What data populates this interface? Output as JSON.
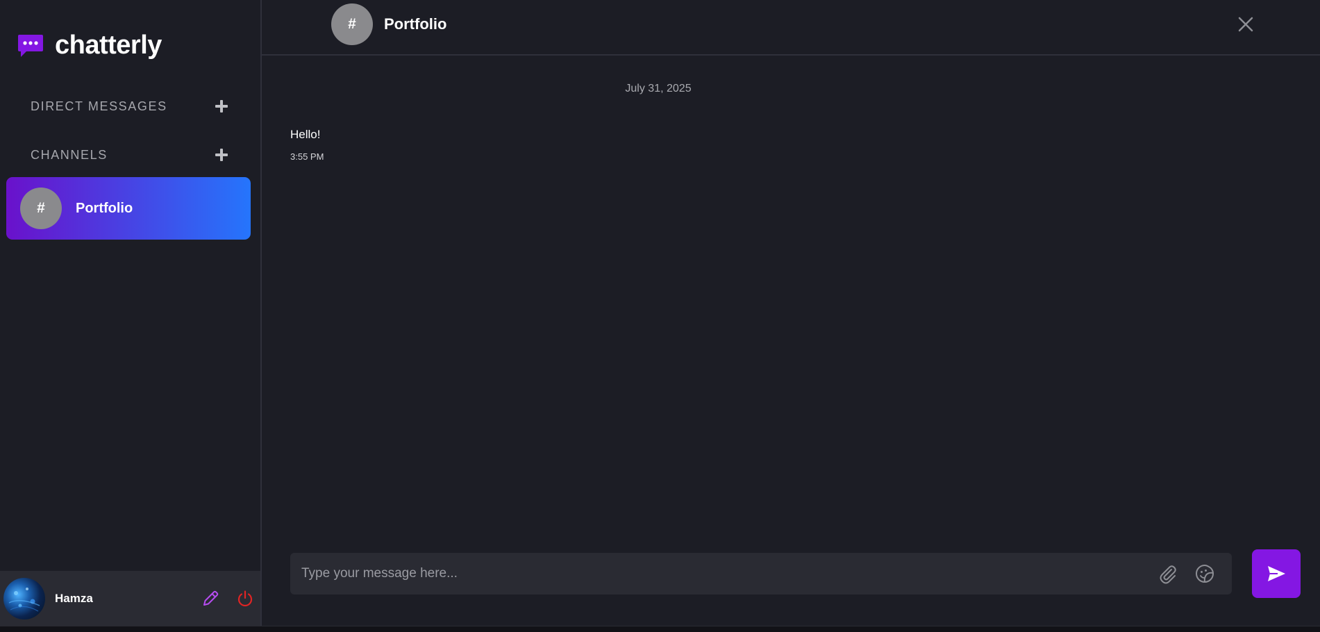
{
  "app": {
    "name": "chatterly"
  },
  "sidebar": {
    "direct_messages_title": "DIRECT MESSAGES",
    "channels_title": "CHANNELS",
    "channels": [
      {
        "symbol": "#",
        "name": "Portfolio",
        "active": true
      }
    ]
  },
  "user": {
    "name": "Hamza"
  },
  "chat": {
    "header_symbol": "#",
    "title": "Portfolio",
    "date_divider": "July 31, 2025",
    "messages": [
      {
        "text": "Hello!",
        "time": "3:55 PM"
      }
    ],
    "input_placeholder": "Type your message here..."
  },
  "colors": {
    "brand_purple": "#8417e3",
    "gradient_start": "#6a11cb",
    "gradient_end": "#2575fc",
    "logout_red": "#e02424",
    "edit_purple": "#b64cf0"
  },
  "icons": {
    "logo": "chat-bubble-dots-icon",
    "add": "plus-icon",
    "edit": "pencil-icon",
    "logout": "power-icon",
    "close": "close-icon",
    "attach": "paperclip-icon",
    "emoji": "sticker-smile-icon",
    "send": "send-icon"
  }
}
